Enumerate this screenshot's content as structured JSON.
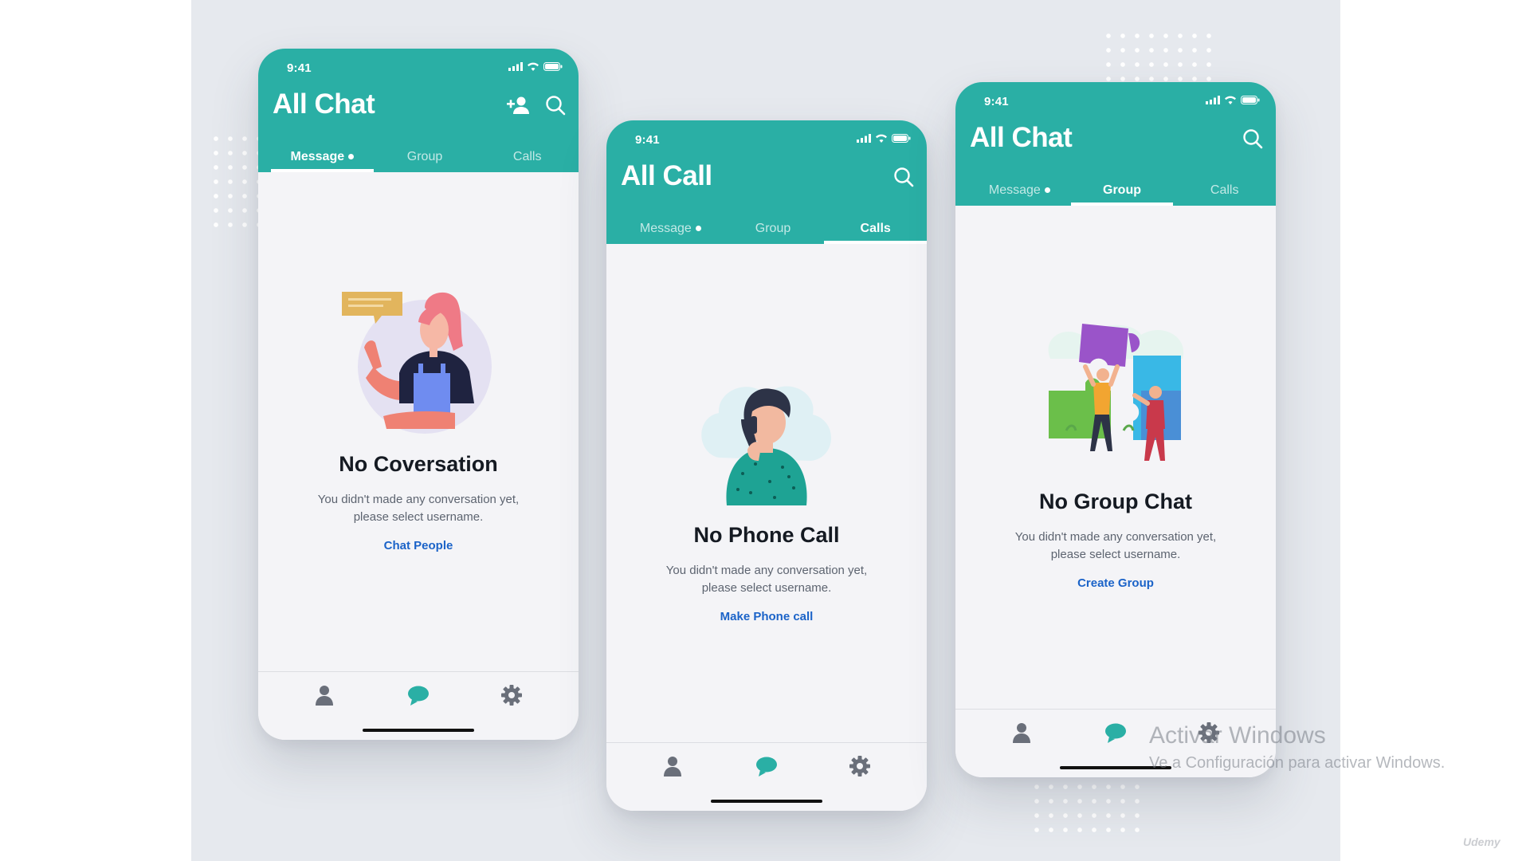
{
  "colors": {
    "accent": "#2aafa5",
    "link": "#1b63c8",
    "background": "#e6e9ee"
  },
  "phones": [
    {
      "time": "9:41",
      "title": "All Chat",
      "tabs": [
        {
          "label": "Message",
          "active": true,
          "has_dot": true
        },
        {
          "label": "Group",
          "active": false
        },
        {
          "label": "Calls",
          "active": false
        }
      ],
      "header_icons": [
        "add-user-icon",
        "search-icon"
      ],
      "empty_title": "No Coversation",
      "empty_line1": "You didn't made any conversation yet,",
      "empty_line2": "please select username.",
      "action": "Chat People",
      "illustration": "waving-person-illustration"
    },
    {
      "time": "9:41",
      "title": "All Call",
      "tabs": [
        {
          "label": "Message",
          "active": false,
          "has_dot": true
        },
        {
          "label": "Group",
          "active": false
        },
        {
          "label": "Calls",
          "active": true
        }
      ],
      "header_icons": [
        "search-icon"
      ],
      "empty_title": "No Phone Call",
      "empty_line1": "You didn't made any conversation yet,",
      "empty_line2": "please select username.",
      "action": "Make Phone call",
      "illustration": "phone-call-woman-illustration"
    },
    {
      "time": "9:41",
      "title": "All Chat",
      "tabs": [
        {
          "label": "Message",
          "active": false,
          "has_dot": true
        },
        {
          "label": "Group",
          "active": true
        },
        {
          "label": "Calls",
          "active": false
        }
      ],
      "header_icons": [
        "search-icon"
      ],
      "empty_title": "No Group Chat",
      "empty_line1": "You didn't made any conversation yet,",
      "empty_line2": "please select username.",
      "action": "Create Group",
      "illustration": "puzzle-team-illustration"
    }
  ],
  "bottom_nav_icons": [
    "person-icon",
    "chat-bubble-icon",
    "gear-icon"
  ],
  "watermark": {
    "line1": "Activar Windows",
    "line2": "Ve a Configuración para activar Windows."
  },
  "brand": "Udemy"
}
